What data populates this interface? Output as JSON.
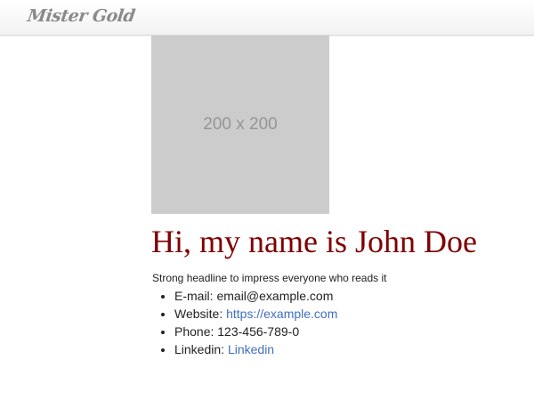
{
  "navbar": {
    "brand": "Mister Gold"
  },
  "profile": {
    "image_placeholder": "200 x 200",
    "headline": "Hi, my name is John Doe",
    "tagline": "Strong headline to impress everyone who reads it"
  },
  "contacts": [
    {
      "label": "E-mail: ",
      "value": "email@example.com",
      "link": false
    },
    {
      "label": "Website: ",
      "value": "https://example.com",
      "link": true
    },
    {
      "label": "Phone: ",
      "value": "123-456-789-0",
      "link": false
    },
    {
      "label": "Linkedin: ",
      "value": "Linkedin",
      "link": true
    }
  ],
  "colors": {
    "headline": "#800000",
    "link": "#3f6fbf",
    "placeholder_bg": "#cccccc"
  }
}
